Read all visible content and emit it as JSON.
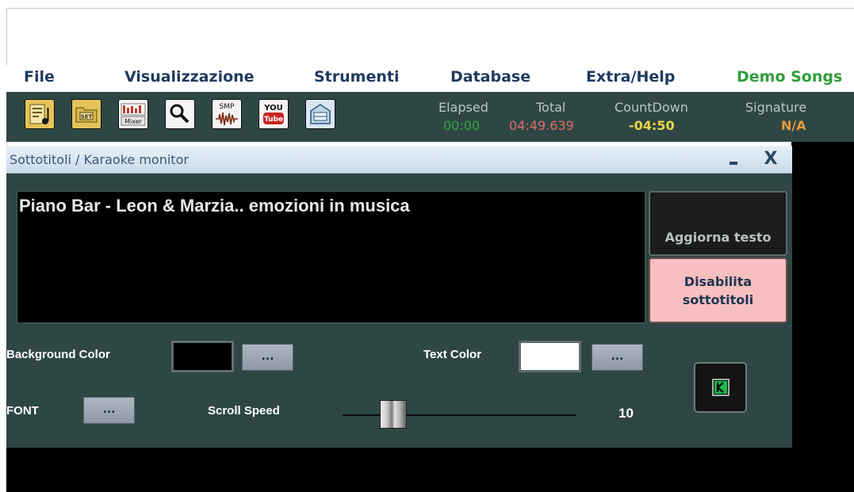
{
  "menu": [
    {
      "label": "File",
      "color": "#1f3a5f"
    },
    {
      "label": "Visualizzazione",
      "color": "#1f3a5f"
    },
    {
      "label": "Strumenti",
      "color": "#1f3a5f"
    },
    {
      "label": "Database",
      "color": "#1f3a5f"
    },
    {
      "label": "Extra/Help",
      "color": "#1f3a5f"
    },
    {
      "label": "Demo Songs",
      "color": "#2f9e3a"
    }
  ],
  "toolbar": {
    "buttons": [
      {
        "icon": "music-file-icon",
        "text": ""
      },
      {
        "icon": "settings-folder-icon",
        "text": "SET"
      },
      {
        "icon": "mixer-icon",
        "text": "Mixer"
      },
      {
        "icon": "search-icon",
        "text": ""
      },
      {
        "icon": "smp-sample-icon",
        "text": "SMP"
      },
      {
        "icon": "youtube-icon",
        "text_top": "YOU",
        "text_bottom": "Tube"
      },
      {
        "icon": "database-icon",
        "text": ""
      }
    ],
    "stats": {
      "elapsed": {
        "label": "Elapsed",
        "value": "00:00",
        "color": "#2fa83a"
      },
      "total": {
        "label": "Total",
        "value": "04:49.639",
        "color": "#e06a6a"
      },
      "countdown": {
        "label": "CountDown",
        "value": "-04:50",
        "color": "#e8d84a"
      },
      "signature": {
        "label": "Signature",
        "value": "N/A",
        "color": "#e89a3a"
      }
    }
  },
  "subtitle_window": {
    "title": "Sottotitoli / Karaoke monitor",
    "minimize_label": "",
    "close_label": "X",
    "text_content": "Piano Bar - Leon & Marzia.. emozioni in musica",
    "update_button": "Aggiorna testo",
    "disable_button_line1": "Disabilita",
    "disable_button_line2": "sottotitoli",
    "background_color_label": "Background Color",
    "background_color_value": "#000000",
    "text_color_label": "Text Color",
    "text_color_value": "#ffffff",
    "dots_label": "...",
    "font_label": "FONT",
    "scroll_speed_label": "Scroll Speed",
    "scroll_speed_value": "10",
    "scroll_speed_fraction": 0.18
  }
}
